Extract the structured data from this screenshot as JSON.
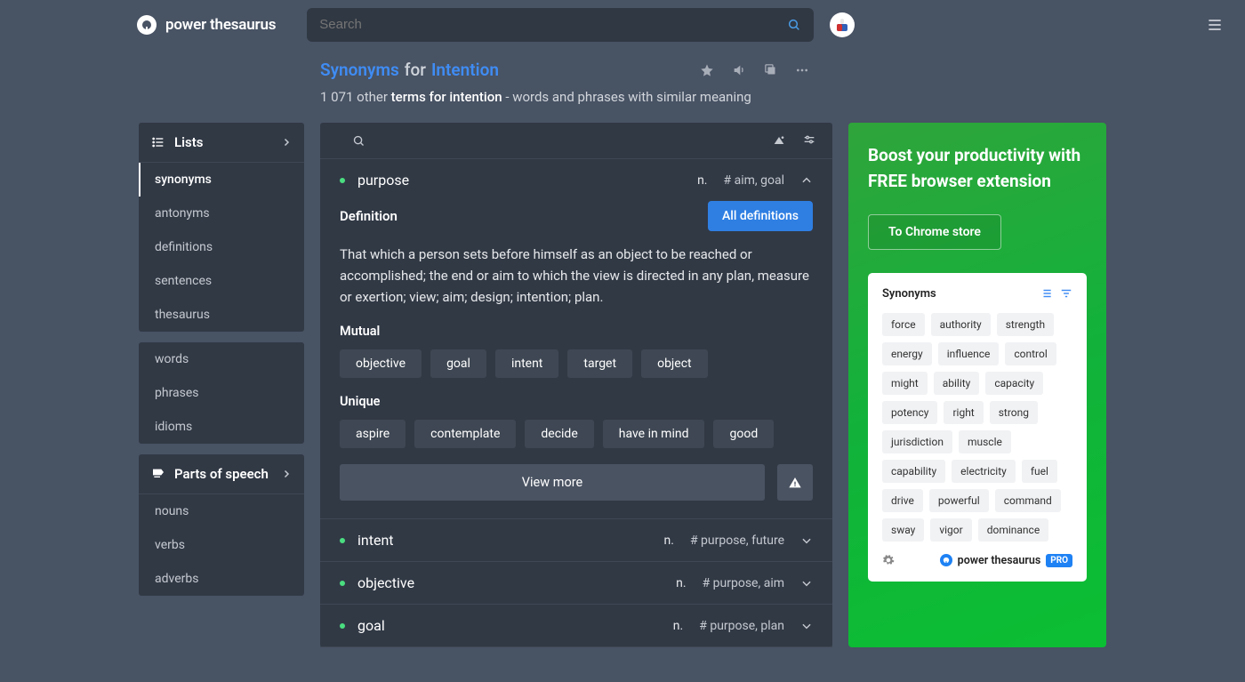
{
  "header": {
    "brand_name": "power thesaurus",
    "search_placeholder": "Search"
  },
  "title": {
    "synonyms": "Synonyms",
    "for": "for",
    "word": "Intention",
    "subtitle_count": "1 071 other",
    "subtitle_bold": "terms for intention",
    "subtitle_rest": "- words and phrases with similar meaning"
  },
  "sidebar": {
    "lists": {
      "label": "Lists",
      "items": [
        "synonyms",
        "antonyms",
        "definitions",
        "sentences",
        "thesaurus"
      ],
      "active_index": 0
    },
    "filters": {
      "items": [
        "words",
        "phrases",
        "idioms"
      ]
    },
    "pos": {
      "label": "Parts of speech",
      "items": [
        "nouns",
        "verbs",
        "adverbs"
      ]
    }
  },
  "results": {
    "expanded": {
      "word": "purpose",
      "pos": "n.",
      "tags": "# aim, goal",
      "def_label": "Definition",
      "all_def": "All definitions",
      "def_text": "That which a person sets before himself as an object to be reached or accomplished; the end or aim to which the view is directed in any plan, measure or exertion; view; aim; design; intention; plan.",
      "mutual_label": "Mutual",
      "mutual": [
        "objective",
        "goal",
        "intent",
        "target",
        "object"
      ],
      "unique_label": "Unique",
      "unique": [
        "aspire",
        "contemplate",
        "decide",
        "have in mind",
        "good"
      ],
      "view_more": "View more"
    },
    "rows": [
      {
        "word": "intent",
        "pos": "n.",
        "tags": "# purpose, future"
      },
      {
        "word": "objective",
        "pos": "n.",
        "tags": "# purpose, aim"
      },
      {
        "word": "goal",
        "pos": "n.",
        "tags": "# purpose, plan"
      }
    ]
  },
  "promo": {
    "title": "Boost your productivity with FREE browser extension",
    "cta": "To Chrome store",
    "preview_label": "Synonyms",
    "preview_chips": [
      "force",
      "authority",
      "strength",
      "energy",
      "influence",
      "control",
      "might",
      "ability",
      "capacity",
      "potency",
      "right",
      "strong",
      "jurisdiction",
      "muscle",
      "capability",
      "electricity",
      "fuel",
      "drive",
      "powerful",
      "command",
      "sway",
      "vigor",
      "dominance"
    ],
    "preview_brand": "power thesaurus",
    "pro": "PRO"
  }
}
